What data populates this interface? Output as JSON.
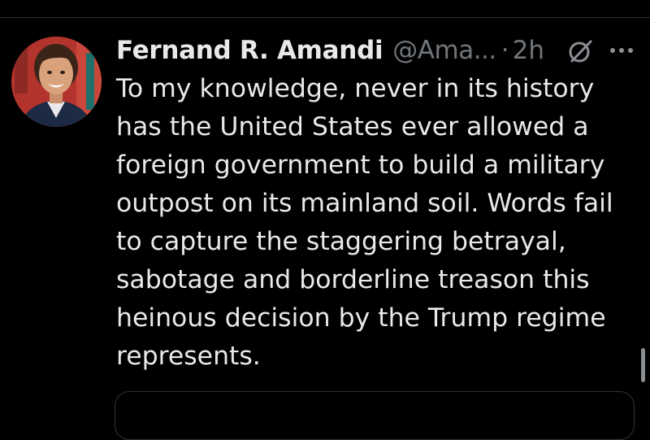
{
  "tweet": {
    "author": {
      "display_name": "Fernand R. Amandi",
      "handle": "@Ama...",
      "avatar_icon": "profile-photo"
    },
    "separator": "·",
    "timestamp": "2h",
    "text_lines": [
      "To my knowledge, never in its history",
      "has the United States ever allowed a",
      "foreign government to build a military",
      "outpost on its mainland soil. Words fail",
      "to capture the staggering betrayal,",
      "sabotage and borderline treason this",
      "heinous decision by the Trump regime",
      "represents."
    ],
    "header_icons": [
      "grok-icon",
      "more-icon"
    ]
  },
  "colors": {
    "background": "#000000",
    "primary_text": "#e7e9ea",
    "secondary_text": "#71767b",
    "divider": "#2f3336",
    "avatar_bg": "#b3342c"
  }
}
